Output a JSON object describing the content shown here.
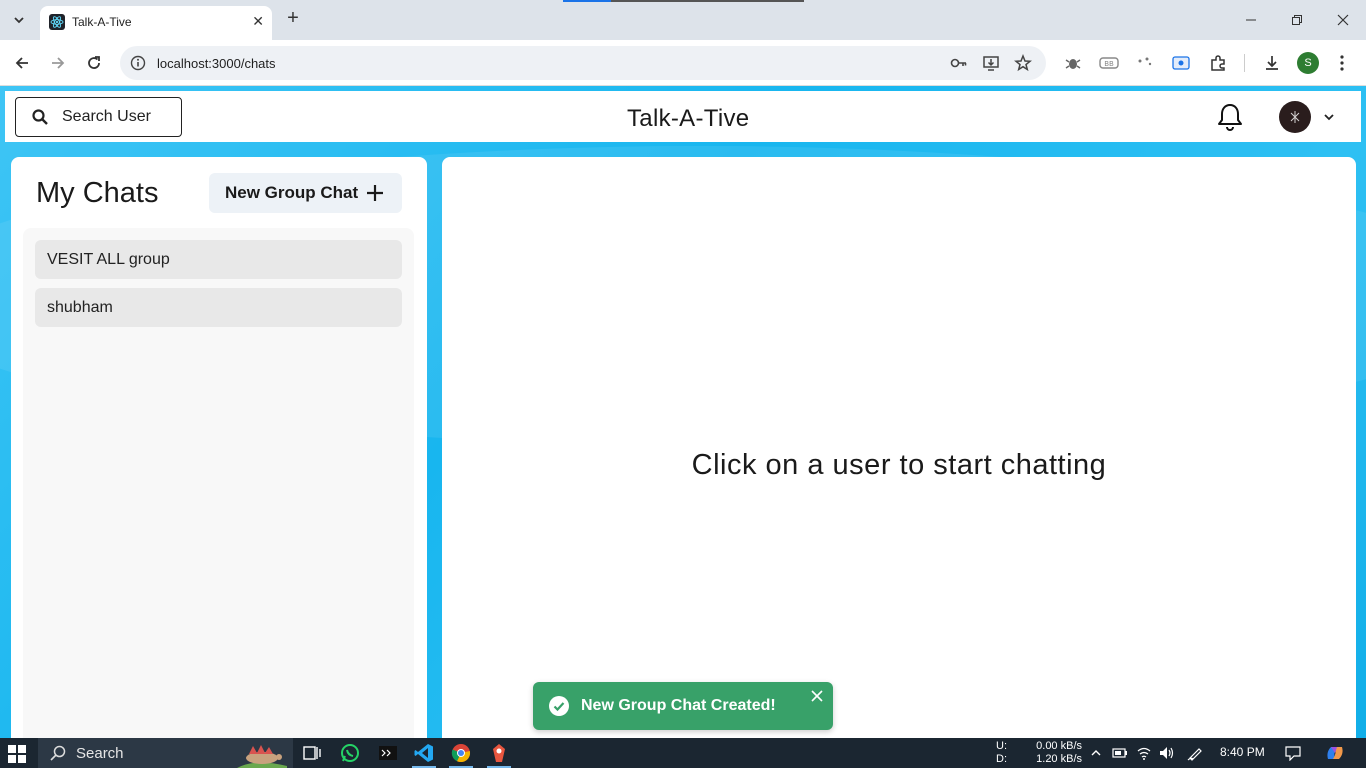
{
  "browser": {
    "tab_title": "Talk-A-Tive",
    "url": "localhost:3000/chats",
    "profile_initial": "S"
  },
  "header": {
    "search_label": "Search User",
    "app_title": "Talk-A-Tive"
  },
  "sidebar": {
    "title": "My Chats",
    "new_group_label": "New Group Chat",
    "chats": [
      {
        "name": "VESIT ALL group"
      },
      {
        "name": "shubham"
      }
    ]
  },
  "chatbox": {
    "placeholder": "Click on a user to start chatting"
  },
  "toast": {
    "message": "New Group Chat Created!",
    "color": "#38a169"
  },
  "taskbar": {
    "search_label": "Search",
    "net_up_label": "U:",
    "net_down_label": "D:",
    "net_up": "0.00 kB/s",
    "net_down": "1.20 kB/s",
    "time": "8:40 PM"
  },
  "colors": {
    "accent_bg": "#18b6ef",
    "panel": "#ffffff"
  }
}
